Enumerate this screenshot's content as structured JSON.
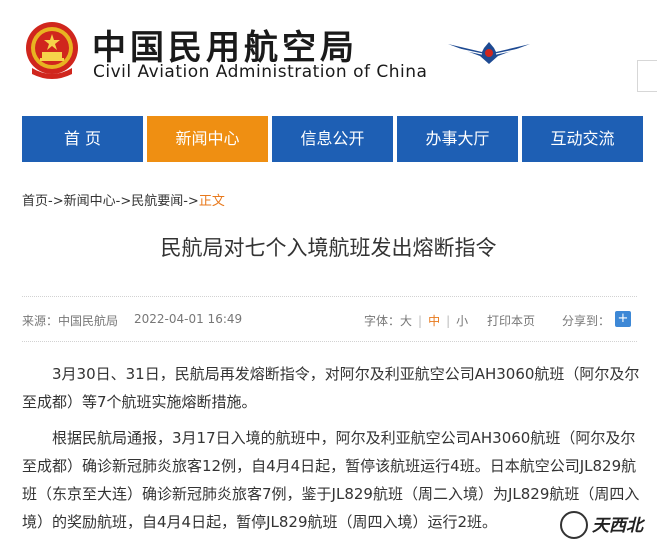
{
  "header": {
    "title_cn": "中国民用航空局",
    "title_en": "Civil Aviation Administration of China"
  },
  "nav": {
    "items": [
      {
        "label": "首 页"
      },
      {
        "label": "新闻中心"
      },
      {
        "label": "信息公开"
      },
      {
        "label": "办事大厅"
      },
      {
        "label": "互动交流"
      }
    ],
    "active_index": 1,
    "colors": {
      "default": "#1e5fb4",
      "active": "#ef8f12"
    }
  },
  "breadcrumb": {
    "home": "首页",
    "sep1": "->",
    "news": "新闻中心",
    "sep2": "->",
    "section": "民航要闻",
    "sep3": "->",
    "current": "正文"
  },
  "article": {
    "title": "民航局对七个入境航班发出熔断指令",
    "source": "来源：中国民航局",
    "time": "2022-04-01 16:49",
    "font_label": "字体：",
    "font_large": "大",
    "font_medium": "中",
    "font_small": "小",
    "print_label": "打印本页",
    "share_label": "分享到：",
    "share_plus": "+",
    "paragraphs": [
      "3月30日、31日，民航局再发熔断指令，对阿尔及利亚航空公司AH3060航班（阿尔及尔至成都）等7个航班实施熔断措施。",
      "根据民航局通报，3月17日入境的航班中，阿尔及利亚航空公司AH3060航班（阿尔及尔至成都）确诊新冠肺炎旅客12例，自4月4日起，暂停该航班运行4班。日本航空公司JL829航班（东京至大连）确诊新冠肺炎旅客7例，鉴于JL829航班（周二入境）为JL829航班（周四入境）的奖励航班，自4月4日起，暂停JL829航班（周四入境）运行2班。"
    ]
  },
  "watermark": {
    "text": "天西北"
  }
}
